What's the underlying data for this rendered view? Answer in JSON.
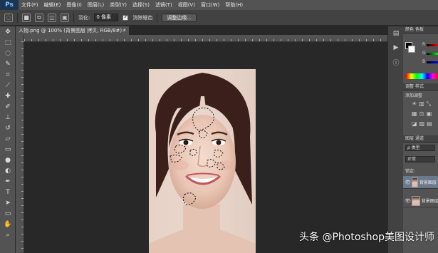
{
  "app": {
    "logo": "Ps"
  },
  "menu": [
    "文件(F)",
    "编辑(E)",
    "图像(I)",
    "图层(L)",
    "类型(Y)",
    "选择(S)",
    "滤镜(T)",
    "视图(V)",
    "窗口(W)",
    "帮助(H)"
  ],
  "options": {
    "feather_label": "羽化:",
    "feather_value": "0 像素",
    "antialias_label": "消除锯齿",
    "refine_edge_label": "调整边缘..."
  },
  "document": {
    "tab_title": "人物.png @ 100% (背景图层 拷贝, RGB/8#) *",
    "close": "×"
  },
  "panels": {
    "color_tab": "颜色",
    "swatches_tab": "色板",
    "r": "R",
    "g": "G",
    "b": "B",
    "adjust_tab": "调整",
    "styles_tab": "样式",
    "add_adjust": "添加调整",
    "layers_tab": "图层",
    "channels_tab": "通道",
    "kind_filter": "ρ 类型",
    "blend_mode": "正常",
    "lock_label": "锁定:",
    "layers": [
      {
        "name": "背景图层 拷贝"
      },
      {
        "name": "背景图层"
      }
    ]
  },
  "colors": {
    "fg": "#000000",
    "bg": "#ffffff",
    "accent": "#6a7a8c"
  },
  "watermark": "头条 @Photoshop美图设计师"
}
